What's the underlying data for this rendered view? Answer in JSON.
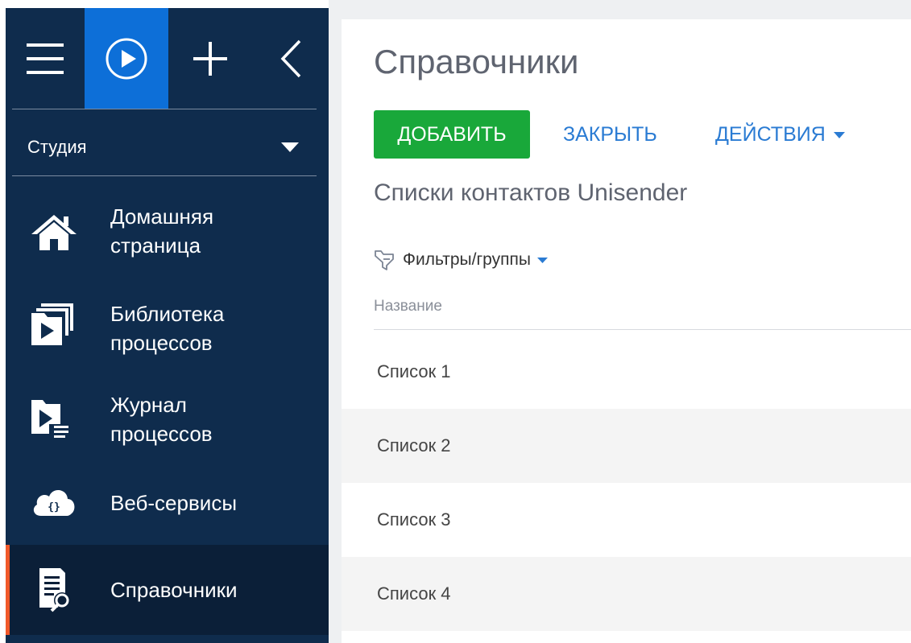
{
  "sidebar": {
    "workspace": "Студия",
    "items": [
      {
        "label_line1": "Домашняя",
        "label_line2": "страница",
        "icon": "home-icon"
      },
      {
        "label_line1": "Библиотека",
        "label_line2": "процессов",
        "icon": "process-library-icon"
      },
      {
        "label_line1": "Журнал",
        "label_line2": "процессов",
        "icon": "process-log-icon"
      },
      {
        "label": "Веб-сервисы",
        "icon": "web-services-cloud-icon"
      },
      {
        "label": "Справочники",
        "icon": "lookups-icon",
        "active": true
      }
    ]
  },
  "colors": {
    "sidebar_bg": "#0f2c4d",
    "active_bg": "#0b1f38",
    "run_button": "#0d6fd8",
    "active_marker": "#f1592a",
    "add_button": "#19a83a",
    "link": "#2a7bd3"
  },
  "main": {
    "title": "Справочники",
    "buttons": {
      "add": "ДОБАВИТЬ",
      "close": "ЗАКРЫТЬ",
      "actions": "ДЕЙСТВИЯ"
    },
    "section_title": "Списки контактов Unisender",
    "filters_label": "Фильтры/группы",
    "column_header": "Название",
    "rows": [
      "Список 1",
      "Список 2",
      "Список 3",
      "Список 4"
    ]
  }
}
